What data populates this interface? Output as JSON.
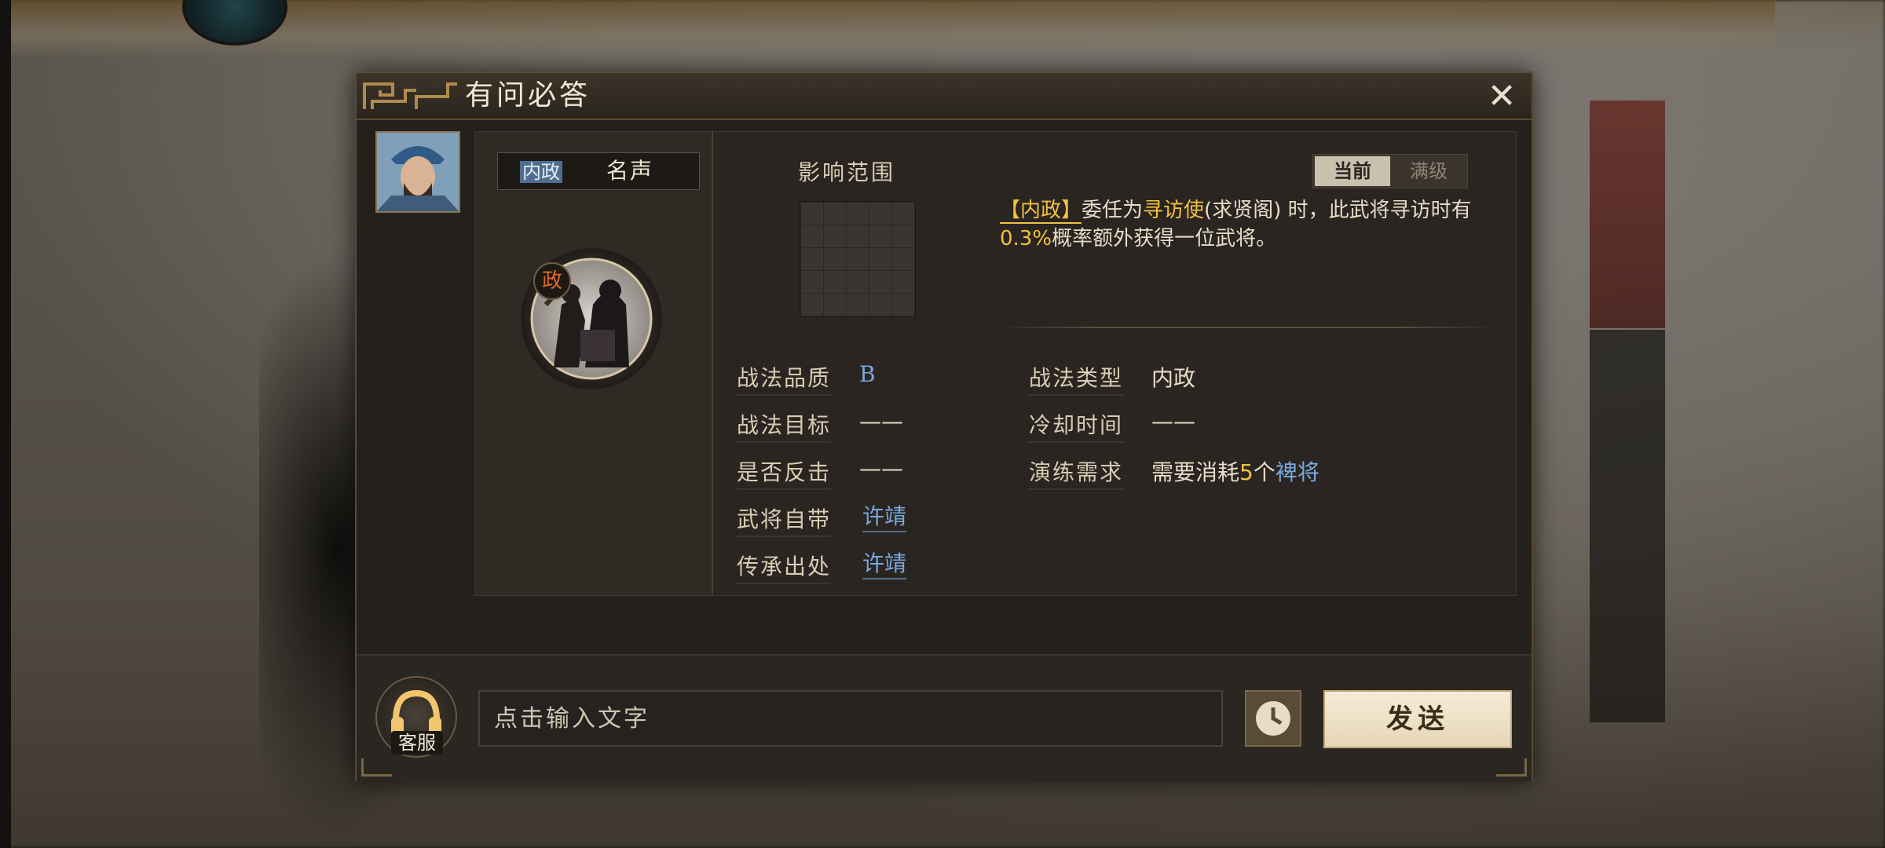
{
  "dialog": {
    "title": "有问必答",
    "close_symbol": "✕"
  },
  "tabs": {
    "active_label": "内政",
    "other_label": "名声"
  },
  "skill": {
    "badge": "政",
    "range_label": "影响范围",
    "level_current": "当前",
    "level_max": "满级",
    "desc_tag": "【内政】",
    "desc_1": "委任为",
    "desc_role": "寻访使",
    "desc_2": "(求贤阁) 时，此武将寻访时有",
    "desc_rate": "0.3%",
    "desc_3": "概率额外获得一位武将。"
  },
  "attributes": {
    "quality_label": "战法品质",
    "quality_value": "B",
    "target_label": "战法目标",
    "target_value": "——",
    "counter_label": "是否反击",
    "counter_value": "——",
    "own_label": "武将自带",
    "own_value": "许靖",
    "inherit_label": "传承出处",
    "inherit_value": "许靖",
    "type_label": "战法类型",
    "type_value": "内政",
    "cooldown_label": "冷却时间",
    "cooldown_value": "——",
    "train_label": "演练需求",
    "train_prefix": "需要消耗",
    "train_count": "5",
    "train_unit": "个",
    "train_target": "裨将"
  },
  "chat": {
    "service_label": "客服",
    "input_placeholder": "点击输入文字",
    "send_label": "发送"
  },
  "icons": {
    "close": "close-icon",
    "clock": "clock-icon",
    "headset": "headset-icon"
  }
}
